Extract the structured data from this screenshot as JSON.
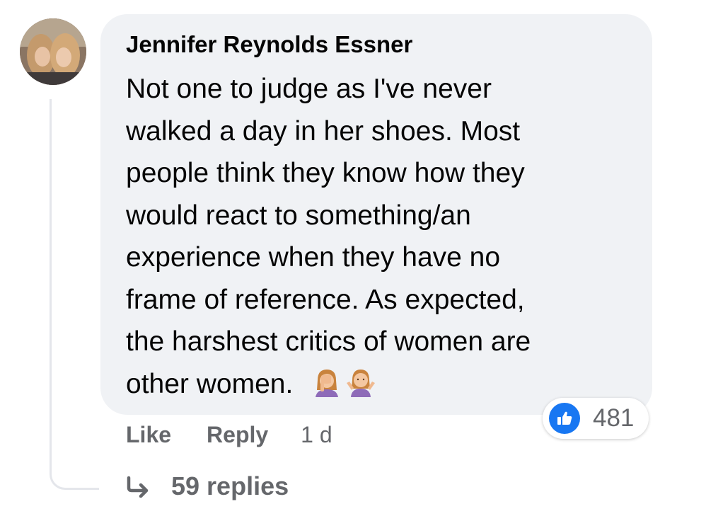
{
  "comment": {
    "author": "Jennifer Reynolds Essner",
    "text_lines": [
      "Not one to judge as I've never",
      "walked a day in her shoes. Most",
      "people think they know how they",
      "would react to something/an",
      "experience when they have no",
      "frame of reference. As expected,",
      "the harshest critics of women are",
      "other women."
    ],
    "emojis": [
      "face-palm-woman-icon",
      "shrug-woman-icon"
    ],
    "reaction_icon": "thumbs-up-icon",
    "reaction_count": "481",
    "actions": {
      "like_label": "Like",
      "reply_label": "Reply",
      "timestamp": "1 d"
    },
    "replies_label": "59 replies"
  },
  "colors": {
    "bubble_background": "#f0f2f5",
    "text_primary": "#050505",
    "text_secondary": "#65676b",
    "like_blue": "#1877f2",
    "thread_line": "#e4e6eb"
  }
}
